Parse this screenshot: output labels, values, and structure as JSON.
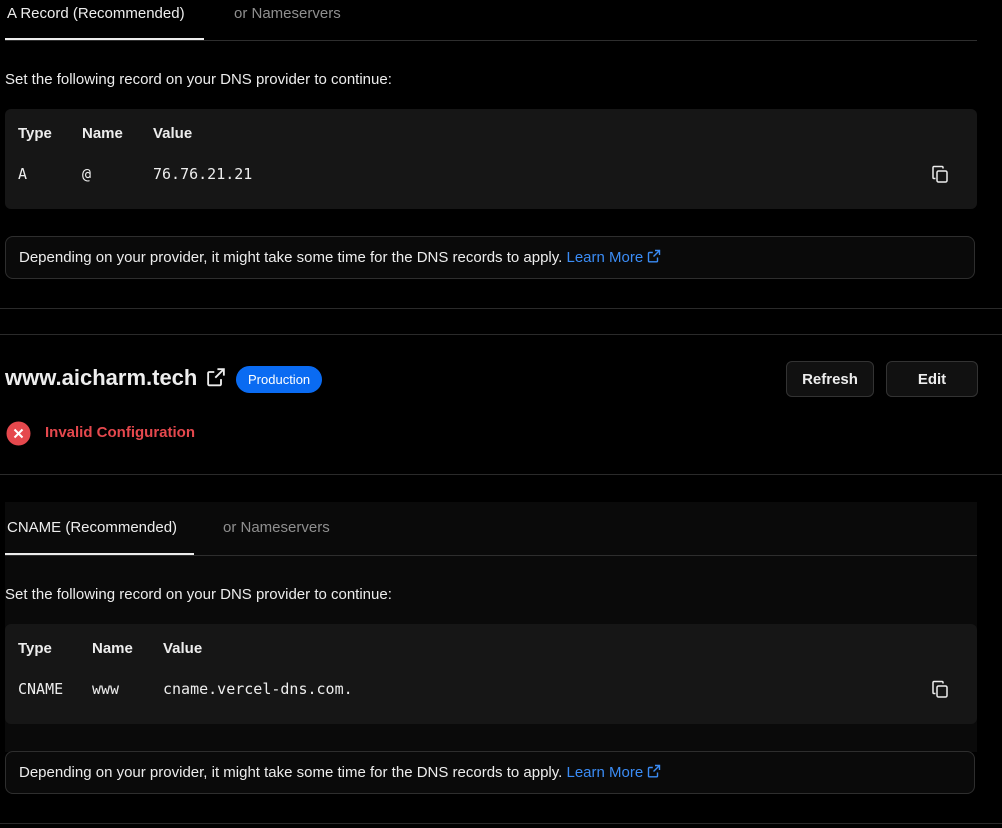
{
  "section1": {
    "tabs": [
      {
        "label": "A Record (Recommended)"
      },
      {
        "label": "or Nameservers"
      }
    ],
    "instruction": "Set the following record on your DNS provider to continue:",
    "table": {
      "headers": {
        "type": "Type",
        "name": "Name",
        "value": "Value"
      },
      "row": {
        "type": "A",
        "name": "@",
        "value": "76.76.21.21"
      }
    },
    "notice": {
      "text": "Depending on your provider, it might take some time for the DNS records to apply.",
      "link": "Learn More"
    }
  },
  "domain": {
    "name": "www.aicharm.tech",
    "badge": "Production",
    "badge_color": "#0a6bf2",
    "refresh_label": "Refresh",
    "edit_label": "Edit",
    "status": "Invalid Configuration",
    "status_color": "#e5484d"
  },
  "section2": {
    "tabs": [
      {
        "label": "CNAME (Recommended)"
      },
      {
        "label": "or Nameservers"
      }
    ],
    "instruction": "Set the following record on your DNS provider to continue:",
    "table": {
      "headers": {
        "type": "Type",
        "name": "Name",
        "value": "Value"
      },
      "row": {
        "type": "CNAME",
        "name": "www",
        "value": "cname.vercel-dns.com."
      }
    },
    "notice": {
      "text": "Depending on your provider, it might take some time for the DNS records to apply.",
      "link": "Learn More"
    }
  },
  "icons": {
    "copy": "copy-icon",
    "external": "external-link-icon",
    "error": "x-circle-icon"
  }
}
